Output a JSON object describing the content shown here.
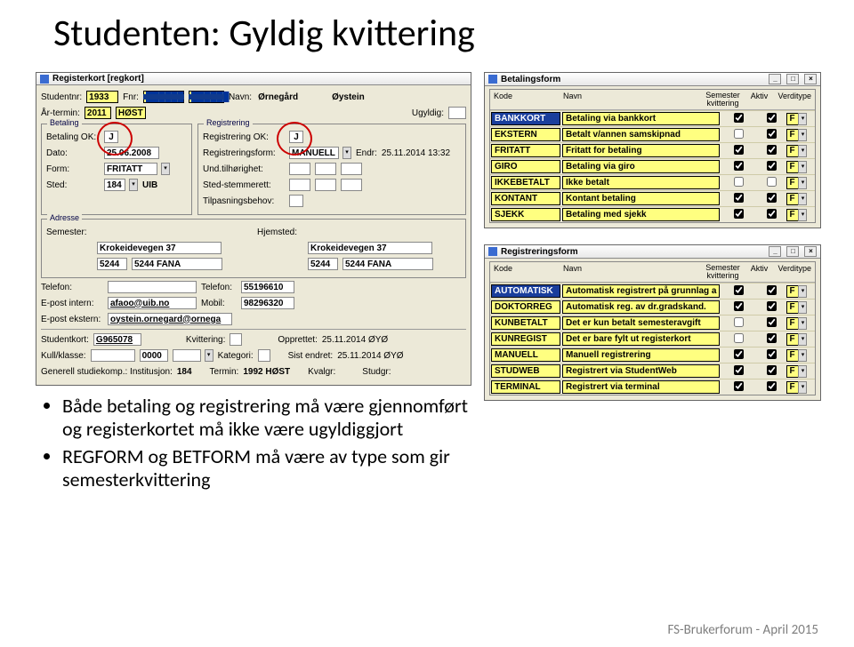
{
  "title": "Studenten: Gyldig kvittering",
  "footer": "FS-Brukerforum - April 2015",
  "bullets": [
    "Både betaling og registrering må være gjennomført og registerkortet må ikke være ugyldiggjort",
    "REGFORM og BETFORM må være av type som gir semesterkvittering"
  ],
  "regkort": {
    "title": "Registerkort  [regkort]",
    "studentnr_lbl": "Studentnr:",
    "studentnr": "1933",
    "fnr_lbl": "Fnr:",
    "fnr_a": "██████",
    "fnr_b": "██████",
    "navn_lbl": "Navn:",
    "etternavn": "Ørnegård",
    "fornavn": "Øystein",
    "aar_lbl": "År-termin:",
    "aar": "2011",
    "termin": "HØST",
    "ugyldig_lbl": "Ugyldig:",
    "betaling_legend": "Betaling",
    "betok_lbl": "Betaling OK:",
    "betok": "J",
    "dato_lbl": "Dato:",
    "dato": "25.06.2008",
    "form_lbl": "Form:",
    "form": "FRITATT",
    "sted_lbl": "Sted:",
    "sted_a": "184",
    "sted_b": "UIB",
    "reg_legend": "Registrering",
    "regok_lbl": "Registrering OK:",
    "regok": "J",
    "regform_lbl": "Registreringsform:",
    "regform": "MANUELL",
    "endr_lbl": "Endr:",
    "endr": "25.11.2014 13:32",
    "undtilh_lbl": "Und.tilhørighet:",
    "stedstem_lbl": "Sted-stemmerett:",
    "tilpasn_lbl": "Tilpasningsbehov:",
    "adresse_legend": "Adresse",
    "semester_lbl": "Semester:",
    "hjemsted_lbl": "Hjemsted:",
    "addr1": "Krokeidevegen 37",
    "addr2": "5244",
    "addr3": "5244 FANA",
    "telefon_lbl": "Telefon:",
    "tel1": "55196610",
    "epost_int_lbl": "E-post intern:",
    "epost_int": "afaoo@uib.no",
    "mobil_lbl": "Mobil:",
    "mobil": "98296320",
    "epost_ext_lbl": "E-post ekstern:",
    "epost_ext": "oystein.ornegard@ornega",
    "studkort_lbl": "Studentkort:",
    "studkort": "G965078",
    "kvitt_lbl": "Kvittering:",
    "opprettet_lbl": "Opprettet:",
    "opprettet": "25.11.2014  ØYØ",
    "kull_lbl": "Kull/klasse:",
    "kull": "0000",
    "kategori_lbl": "Kategori:",
    "sistendr_lbl": "Sist endret:",
    "sistendr": "25.11.2014  ØYØ",
    "gen_lbl": "Generell studiekomp.:  Institusjon:",
    "inst": "184",
    "termin2_lbl": "Termin:",
    "termin2": "1992 HØST",
    "kvalgr_lbl": "Kvalgr:",
    "studgr_lbl": "Studgr:"
  },
  "betform": {
    "title": "Betalingsform",
    "h_kode": "Kode",
    "h_navn": "Navn",
    "h_kvitt1": "Semester",
    "h_kvitt2": "kvittering",
    "h_aktiv": "Aktiv",
    "h_verdi": "Verditype",
    "rows": [
      {
        "code": "BANKKORT",
        "navn": "Betaling via bankkort",
        "kv": true,
        "ak": true,
        "vt": "F",
        "sel": true
      },
      {
        "code": "EKSTERN",
        "navn": "Betalt v/annen samskipnad",
        "kv": false,
        "ak": true,
        "vt": "F"
      },
      {
        "code": "FRITATT",
        "navn": "Fritatt for betaling",
        "kv": true,
        "ak": true,
        "vt": "F"
      },
      {
        "code": "GIRO",
        "navn": "Betaling via giro",
        "kv": true,
        "ak": true,
        "vt": "F"
      },
      {
        "code": "IKKEBETALT",
        "navn": "Ikke betalt",
        "kv": false,
        "ak": false,
        "vt": "F"
      },
      {
        "code": "KONTANT",
        "navn": "Kontant betaling",
        "kv": true,
        "ak": true,
        "vt": "F"
      },
      {
        "code": "SJEKK",
        "navn": "Betaling med sjekk",
        "kv": true,
        "ak": true,
        "vt": "F"
      }
    ]
  },
  "regform": {
    "title": "Registreringsform",
    "h_kode": "Kode",
    "h_navn": "Navn",
    "h_kvitt1": "Semester",
    "h_kvitt2": "kvittering",
    "h_aktiv": "Aktiv",
    "h_verdi": "Verditype",
    "rows": [
      {
        "code": "AUTOMATISK",
        "navn": "Automatisk registrert på grunnlag a",
        "kv": true,
        "ak": true,
        "vt": "F",
        "sel": true
      },
      {
        "code": "DOKTORREG",
        "navn": "Automatisk reg. av dr.gradskand.",
        "kv": true,
        "ak": true,
        "vt": "F"
      },
      {
        "code": "KUNBETALT",
        "navn": "Det er kun betalt semesteravgift",
        "kv": false,
        "ak": true,
        "vt": "F"
      },
      {
        "code": "KUNREGIST",
        "navn": "Det er bare fylt ut registerkort",
        "kv": false,
        "ak": true,
        "vt": "F"
      },
      {
        "code": "MANUELL",
        "navn": "Manuell registrering",
        "kv": true,
        "ak": true,
        "vt": "F"
      },
      {
        "code": "STUDWEB",
        "navn": "Registrert via StudentWeb",
        "kv": true,
        "ak": true,
        "vt": "F"
      },
      {
        "code": "TERMINAL",
        "navn": "Registrert via terminal",
        "kv": true,
        "ak": true,
        "vt": "F"
      }
    ]
  }
}
